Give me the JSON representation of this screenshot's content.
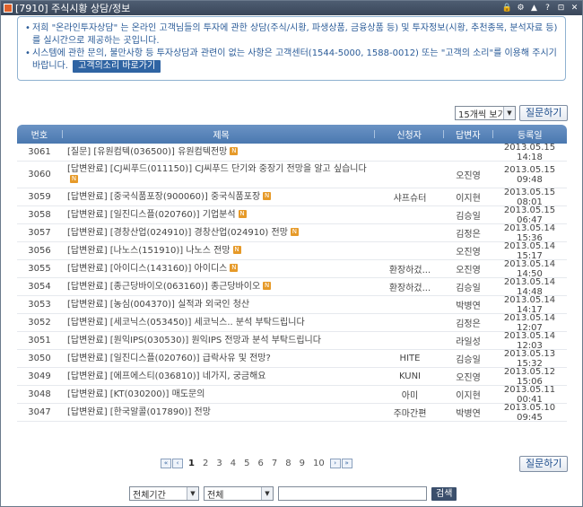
{
  "window": {
    "title": "[7910] 주식시황 상담/정보",
    "title_buttons": [
      "🔒",
      "⚙",
      "▲",
      "?",
      "⊡",
      "✕"
    ]
  },
  "notice": {
    "line1": "저희 \"온라인투자상담\" 는 온라인 고객님들의 투자에 관한 상담(주식/시황, 파생상품, 금융상품 등) 및 투자정보(시황, 추천종목, 분석자료 등)를 실시간으로 제공하는 곳입니다.",
    "line2": "시스템에 관한 문의, 불만사항 등 투자상담과 관련이 없는 사항은 고객센터(1544-5000, 1588-0012) 또는 \"고객의 소리\"를 이용해 주시기 바랍니다.",
    "cs_button": "고객의소리 바로가기"
  },
  "toolbar": {
    "page_size": "15개씩 보기",
    "ask_label": "질문하기"
  },
  "table": {
    "headers": {
      "no": "번호",
      "title": "제목",
      "requester": "신청자",
      "answerer": "답변자",
      "date": "등록일"
    },
    "rows": [
      {
        "no": "3061",
        "title": "[질문] [유원컴텍(036500)] 유원컴텍전망",
        "new": true,
        "requester": "",
        "answerer": "",
        "date": "2013.05.15 14:18"
      },
      {
        "no": "3060",
        "title": "[답변완료] [CJ씨푸드(011150)] CJ씨푸드 단기와 중장기 전망을 알고 싶습니다",
        "new": true,
        "requester": "",
        "answerer": "오진영",
        "date": "2013.05.15 09:48"
      },
      {
        "no": "3059",
        "title": "[답변완료] [중국식품포장(900060)] 중국식품포장",
        "new": true,
        "requester": "샤프슈터",
        "answerer": "이지현",
        "date": "2013.05.15 08:01"
      },
      {
        "no": "3058",
        "title": "[답변완료] [일진디스플(020760)] 기업분석",
        "new": true,
        "requester": "",
        "answerer": "김승일",
        "date": "2013.05.15 06:47"
      },
      {
        "no": "3057",
        "title": "[답변완료] [경창산업(024910)] 경창산업(024910) 전망",
        "new": true,
        "requester": "",
        "answerer": "김정은",
        "date": "2013.05.14 15:36"
      },
      {
        "no": "3056",
        "title": "[답변완료] [나노스(151910)] 나노스 전망",
        "new": true,
        "requester": "",
        "answerer": "오진영",
        "date": "2013.05.14 15:17"
      },
      {
        "no": "3055",
        "title": "[답변완료] [아이디스(143160)] 아이디스",
        "new": true,
        "requester": "환장하겄...",
        "answerer": "오진영",
        "date": "2013.05.14 14:50"
      },
      {
        "no": "3054",
        "title": "[답변완료] [종근당바이오(063160)] 종근당바이오",
        "new": true,
        "requester": "환장하겄...",
        "answerer": "김승일",
        "date": "2013.05.14 14:48"
      },
      {
        "no": "3053",
        "title": "[답변완료] [농심(004370)] 실적과 외국인 청산",
        "new": false,
        "requester": "",
        "answerer": "박병연",
        "date": "2013.05.14 14:17"
      },
      {
        "no": "3052",
        "title": "[답변완료] [세코닉스(053450)] 세코닉스.. 분석 부탁드립니다",
        "new": false,
        "requester": "",
        "answerer": "김정은",
        "date": "2013.05.14 12:07"
      },
      {
        "no": "3051",
        "title": "[답변완료] [원익IPS(030530)] 원익IPS 전망과 분석 부탁드립니다",
        "new": false,
        "requester": "",
        "answerer": "라일성",
        "date": "2013.05.14 12:03"
      },
      {
        "no": "3050",
        "title": "[답변완료] [일진디스플(020760)] 급락사유 및 전망?",
        "new": false,
        "requester": "HITE",
        "answerer": "김승일",
        "date": "2013.05.13 15:32"
      },
      {
        "no": "3049",
        "title": "[답변완료] [에프에스티(036810)] 네가지, 궁금해요",
        "new": false,
        "requester": "KUNI",
        "answerer": "오진영",
        "date": "2013.05.12 15:06"
      },
      {
        "no": "3048",
        "title": "[답변완료] [KT(030200)] 매도문의",
        "new": false,
        "requester": "아미",
        "answerer": "이지현",
        "date": "2013.05.11 00:41"
      },
      {
        "no": "3047",
        "title": "[답변완료] [한국알콜(017890)] 전망",
        "new": false,
        "requester": "주마간편",
        "answerer": "박병연",
        "date": "2013.05.10 09:45"
      }
    ]
  },
  "pager": {
    "first": "«",
    "prev": "‹",
    "next": "›",
    "last": "»",
    "pages": [
      "1",
      "2",
      "3",
      "4",
      "5",
      "6",
      "7",
      "8",
      "9",
      "10"
    ],
    "current": "1"
  },
  "search": {
    "period": "전체기간",
    "field": "전체",
    "query": "",
    "button": "검색"
  },
  "new_badge": "N"
}
